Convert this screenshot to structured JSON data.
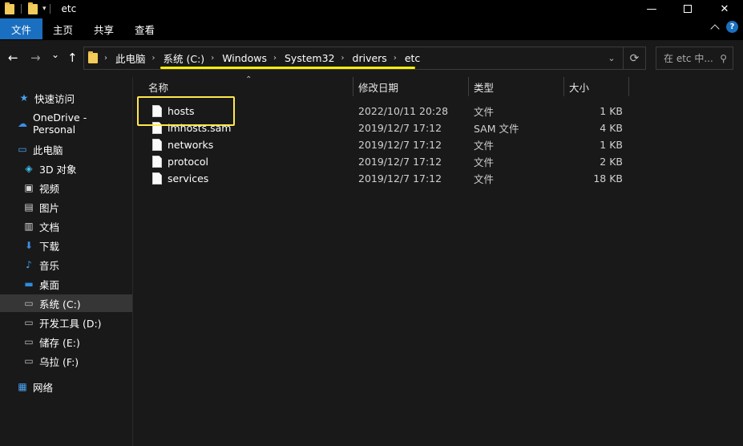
{
  "window": {
    "title": "etc",
    "min_symbol": "—",
    "close_symbol": "✕",
    "dropdown_symbol": "▾"
  },
  "ribbon": {
    "tabs": [
      "文件",
      "主页",
      "共享",
      "查看"
    ],
    "help_symbol": "?"
  },
  "nav": {
    "back": "←",
    "forward": "→",
    "recent": "⌄",
    "up": "↑"
  },
  "address": {
    "crumbs": [
      "此电脑",
      "系统 (C:)",
      "Windows",
      "System32",
      "drivers",
      "etc"
    ],
    "separator": "›",
    "dropdown_symbol": "⌄",
    "refresh_symbol": "⟳"
  },
  "search": {
    "placeholder": "在 etc 中...",
    "icon_symbol": "⚲"
  },
  "sidebar": {
    "items": [
      {
        "label": "快速访问",
        "icon": "star-icon",
        "glyph": "★",
        "color": "#4aa3f0"
      },
      {
        "label": "OneDrive - Personal",
        "icon": "cloud-icon",
        "glyph": "☁",
        "color": "#3b8ee8"
      },
      {
        "label": "此电脑",
        "icon": "computer-icon",
        "glyph": "▭",
        "color": "#4aa3f0"
      },
      {
        "label": "3D 对象",
        "icon": "cube-icon",
        "glyph": "◈",
        "color": "#3fc1f0"
      },
      {
        "label": "视频",
        "icon": "video-icon",
        "glyph": "▣",
        "color": "#d9d9d9"
      },
      {
        "label": "图片",
        "icon": "image-icon",
        "glyph": "▤",
        "color": "#d9d9d9"
      },
      {
        "label": "文档",
        "icon": "document-icon",
        "glyph": "▥",
        "color": "#d9d9d9"
      },
      {
        "label": "下载",
        "icon": "download-icon",
        "glyph": "⬇",
        "color": "#3d8ee0"
      },
      {
        "label": "音乐",
        "icon": "music-icon",
        "glyph": "♪",
        "color": "#3da4f0"
      },
      {
        "label": "桌面",
        "icon": "desktop-icon",
        "glyph": "▬",
        "color": "#2d8ce0"
      },
      {
        "label": "系统 (C:)",
        "icon": "drive-c-icon",
        "glyph": "▭",
        "color": "#bfbfbf",
        "selected": true
      },
      {
        "label": "开发工具 (D:)",
        "icon": "drive-icon",
        "glyph": "▭",
        "color": "#bfbfbf"
      },
      {
        "label": "储存 (E:)",
        "icon": "drive-icon",
        "glyph": "▭",
        "color": "#bfbfbf"
      },
      {
        "label": "乌拉 (F:)",
        "icon": "drive-icon",
        "glyph": "▭",
        "color": "#bfbfbf"
      },
      {
        "label": "网络",
        "icon": "network-icon",
        "glyph": "▦",
        "color": "#4aa3f0"
      }
    ]
  },
  "columns": {
    "name": "名称",
    "modified": "修改日期",
    "type": "类型",
    "size": "大小"
  },
  "files": [
    {
      "name": "hosts",
      "modified": "2022/10/11 20:28",
      "type": "文件",
      "size": "1 KB"
    },
    {
      "name": "lmhosts.sam",
      "modified": "2019/12/7 17:12",
      "type": "SAM 文件",
      "size": "4 KB"
    },
    {
      "name": "networks",
      "modified": "2019/12/7 17:12",
      "type": "文件",
      "size": "1 KB"
    },
    {
      "name": "protocol",
      "modified": "2019/12/7 17:12",
      "type": "文件",
      "size": "2 KB"
    },
    {
      "name": "services",
      "modified": "2019/12/7 17:12",
      "type": "文件",
      "size": "18 KB"
    }
  ],
  "colors": {
    "accent": "#1a6fc0",
    "annotation": "#ffe84a"
  }
}
